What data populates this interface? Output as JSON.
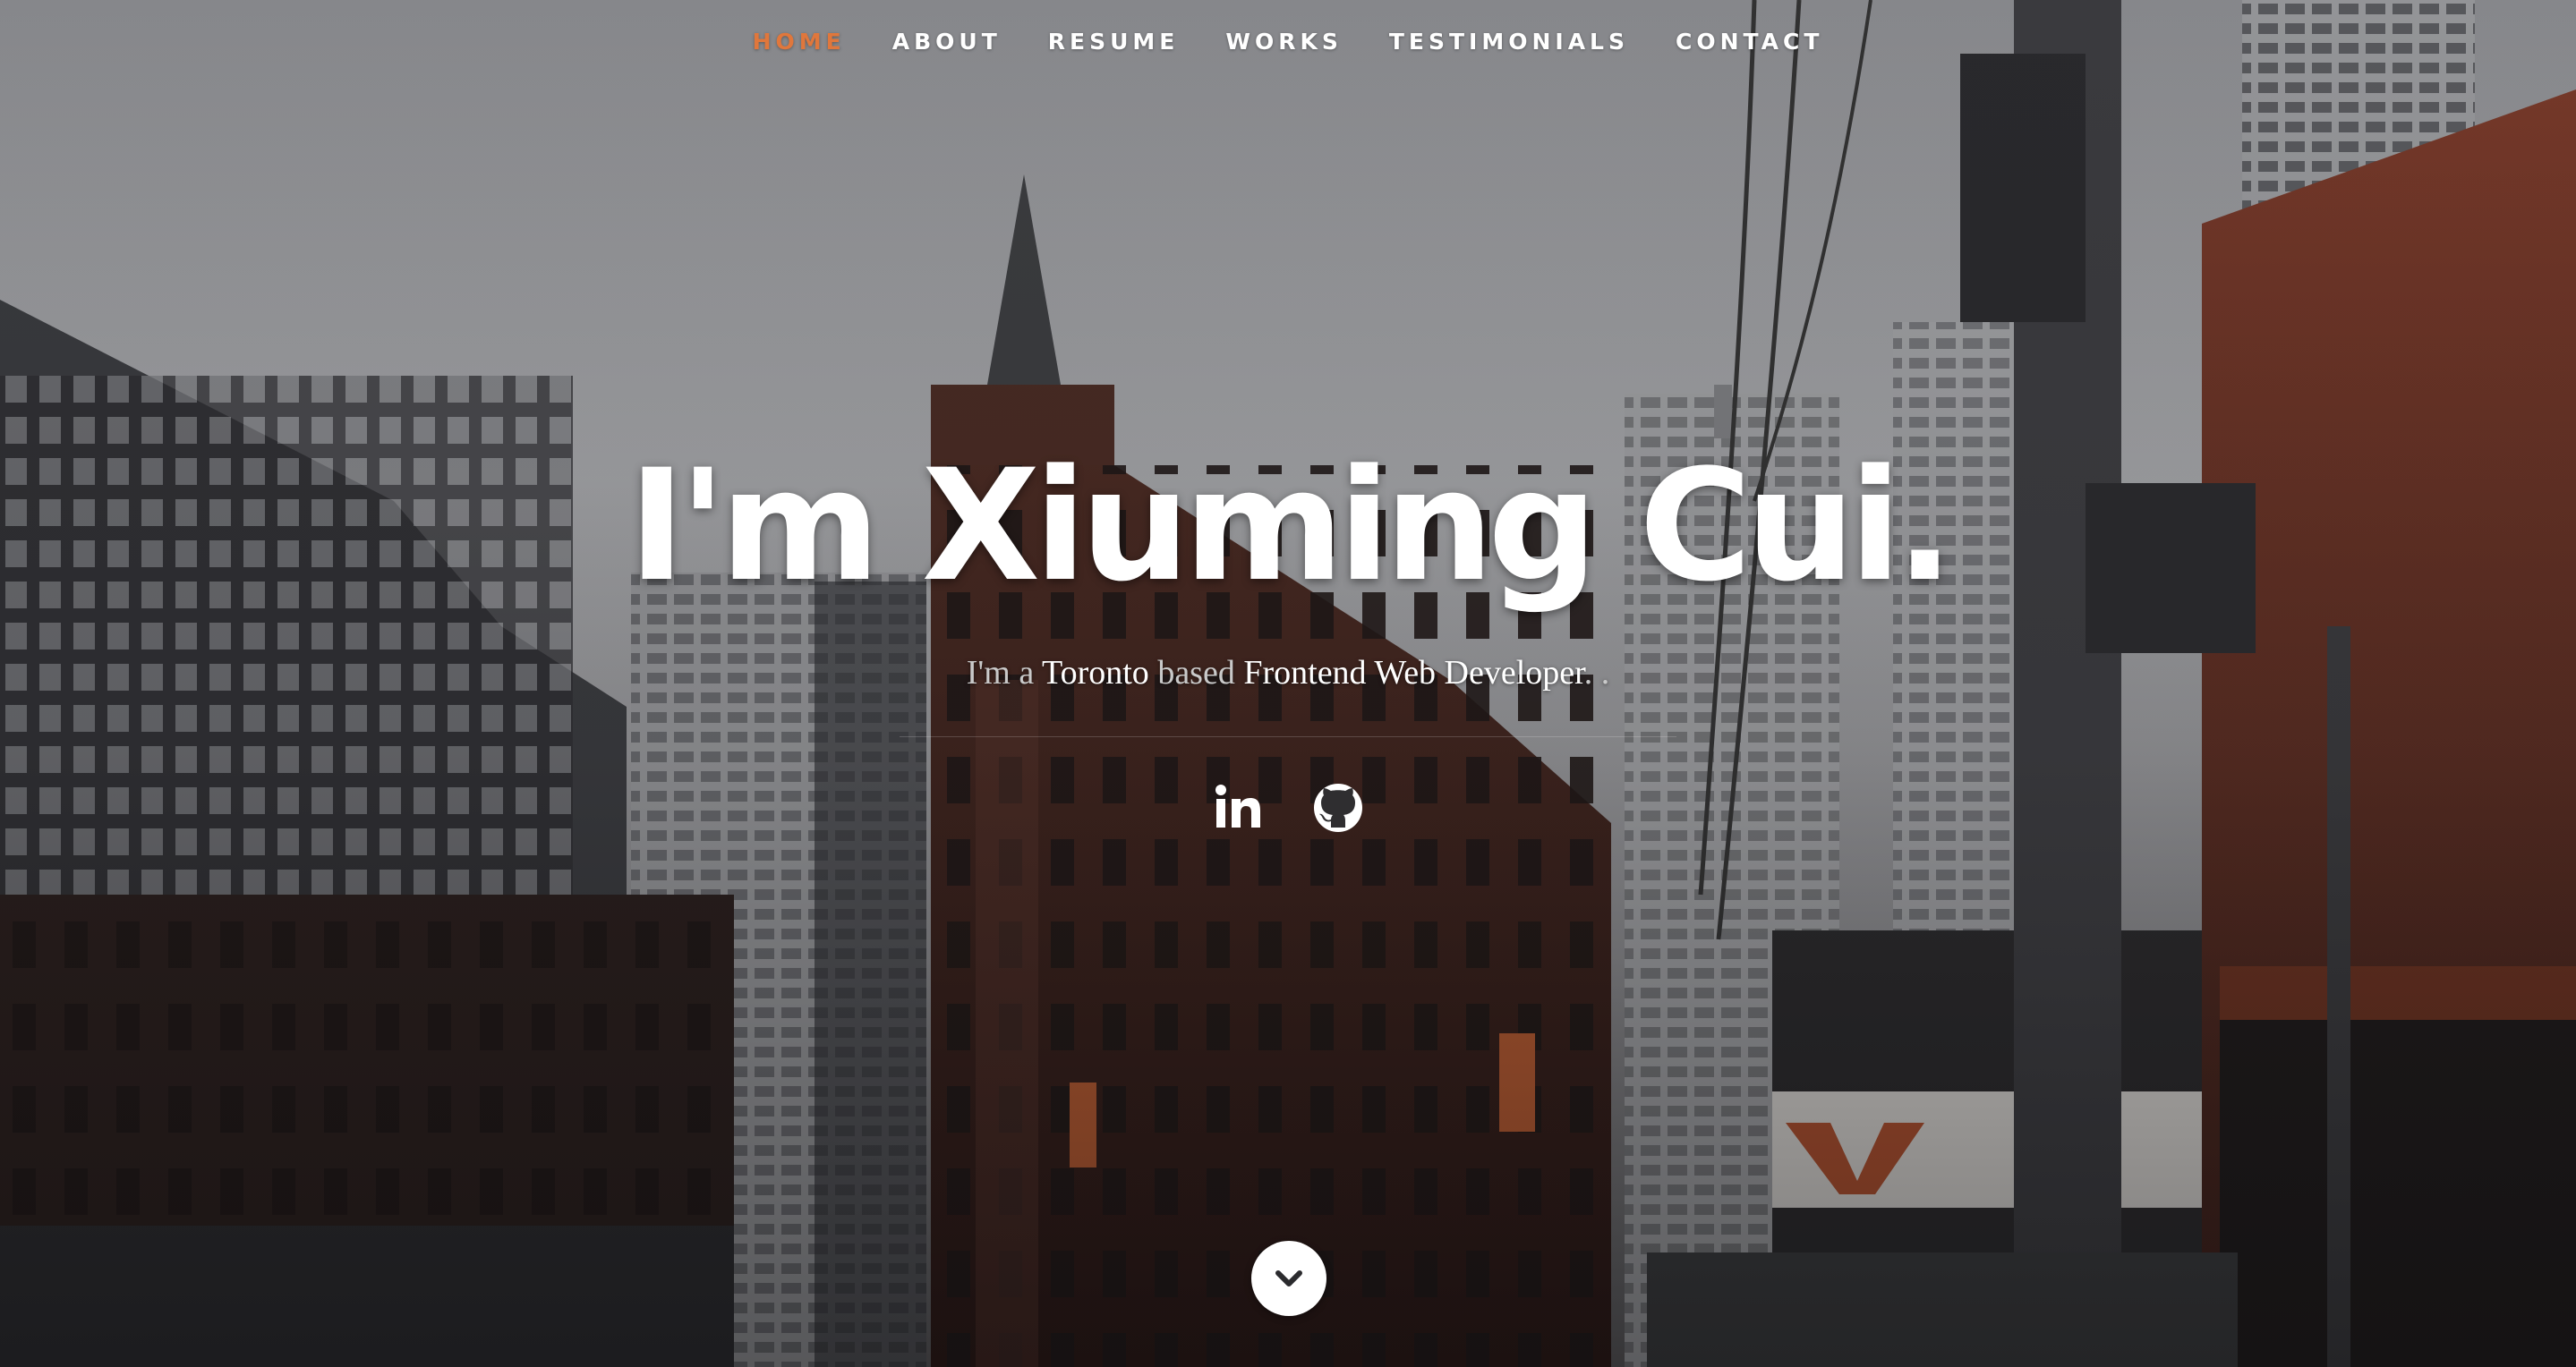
{
  "nav": {
    "items": [
      {
        "label": "HOME",
        "current": true
      },
      {
        "label": "ABOUT",
        "current": false
      },
      {
        "label": "RESUME",
        "current": false
      },
      {
        "label": "WORKS",
        "current": false
      },
      {
        "label": "TESTIMONIALS",
        "current": false
      },
      {
        "label": "CONTACT",
        "current": false
      }
    ]
  },
  "hero": {
    "title": "I'm Xiuming Cui.",
    "subtitle": {
      "p1": "I'm a ",
      "city": "Toronto",
      "p2": " based ",
      "role": "Frontend Web Developer",
      "p3": ". ."
    }
  },
  "social": [
    {
      "icon": "linkedin-icon"
    },
    {
      "icon": "github-icon"
    }
  ],
  "scroll": {
    "icon": "chevron-down-icon"
  },
  "colors": {
    "accent": "#e0773c",
    "text": "#ffffff",
    "subtext": "#c9c9c9"
  }
}
